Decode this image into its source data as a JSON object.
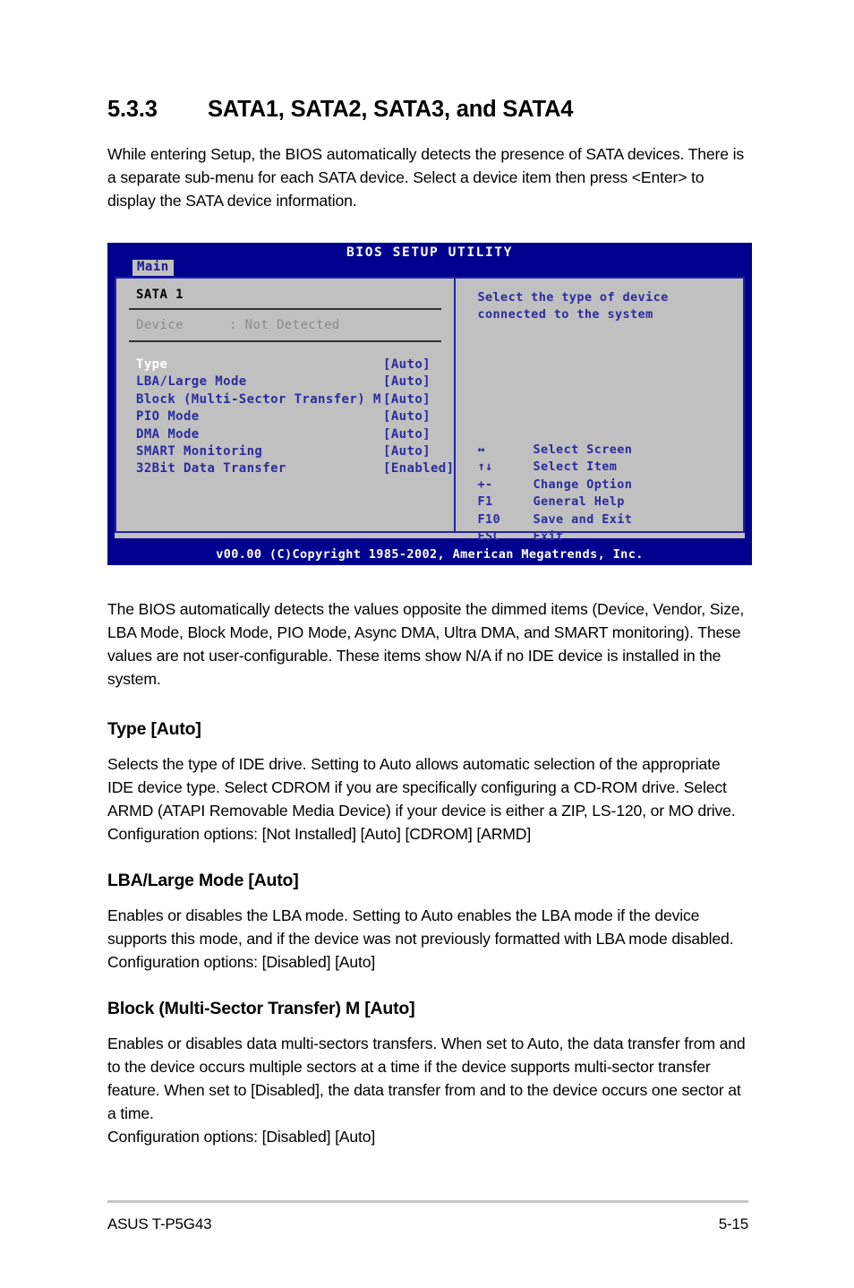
{
  "section": {
    "number": "5.3.3",
    "title": "SATA1, SATA2, SATA3, and SATA4",
    "intro": "While entering Setup, the BIOS automatically detects the presence of SATA devices. There is a separate sub-menu for each SATA device. Select a device item then press <Enter> to display the SATA device information."
  },
  "bios": {
    "title": "BIOS SETUP UTILITY",
    "tab": "Main",
    "panel_heading": "SATA 1",
    "device": {
      "label": "Device",
      "value": ": Not Detected"
    },
    "settings": [
      {
        "label": "Type",
        "value": "[Auto]",
        "selected": true
      },
      {
        "label": "LBA/Large Mode",
        "value": "[Auto]",
        "selected": false
      },
      {
        "label": "Block (Multi-Sector Transfer) M",
        "value": "[Auto]",
        "selected": false
      },
      {
        "label": "PIO Mode",
        "value": "[Auto]",
        "selected": false
      },
      {
        "label": "DMA Mode",
        "value": "[Auto]",
        "selected": false
      },
      {
        "label": "SMART Monitoring",
        "value": "[Auto]",
        "selected": false
      },
      {
        "label": "32Bit Data Transfer",
        "value": "[Enabled]",
        "selected": false
      }
    ],
    "help": "Select the type of device connected to the system",
    "keys": [
      {
        "key": "↔",
        "desc": "Select Screen"
      },
      {
        "key": "↑↓",
        "desc": "Select Item"
      },
      {
        "key": "+-",
        "desc": "Change Option"
      },
      {
        "key": "F1",
        "desc": "General Help"
      },
      {
        "key": "F10",
        "desc": "Save and Exit"
      },
      {
        "key": "ESC",
        "desc": "Exit"
      }
    ],
    "footer": "v00.00 (C)Copyright 1985-2002, American Megatrends, Inc.",
    "colors": {
      "screen_blue": "#00008f",
      "panel_gray": "#c0c0c0",
      "text_blue": "#2b2b9e",
      "dimmed_gray": "#8a8a8a"
    }
  },
  "notes": {
    "detect_paragraph": "The BIOS automatically detects the values opposite the dimmed items (Device, Vendor, Size, LBA Mode, Block Mode, PIO Mode, Async DMA, Ultra DMA, and SMART monitoring). These values are not user-configurable. These items show N/A if no IDE device is installed in the system."
  },
  "topics": [
    {
      "heading": "Type [Auto]",
      "body": "Selects the type of IDE drive. Setting to Auto allows automatic selection of the appropriate IDE device type. Select CDROM if you are specifically configuring a CD-ROM drive. Select ARMD (ATAPI Removable Media Device) if your device is either a ZIP, LS-120, or MO drive. Configuration options: [Not Installed] [Auto] [CDROM] [ARMD]"
    },
    {
      "heading": "LBA/Large Mode [Auto]",
      "body": "Enables or disables the LBA mode. Setting to Auto enables the LBA mode if the device supports this mode, and if the device was not previously formatted with LBA mode disabled. Configuration options: [Disabled] [Auto]"
    },
    {
      "heading": "Block (Multi-Sector Transfer) M [Auto]",
      "body": "Enables or disables data multi-sectors transfers. When set to Auto, the data transfer from and to the device occurs multiple sectors at a time if the device supports multi-sector transfer feature. When set to [Disabled], the data transfer from and to the device occurs one sector at a time.",
      "body2": "Configuration options: [Disabled] [Auto]"
    }
  ],
  "footer": {
    "product": "ASUS T-P5G43",
    "page": "5-15"
  }
}
